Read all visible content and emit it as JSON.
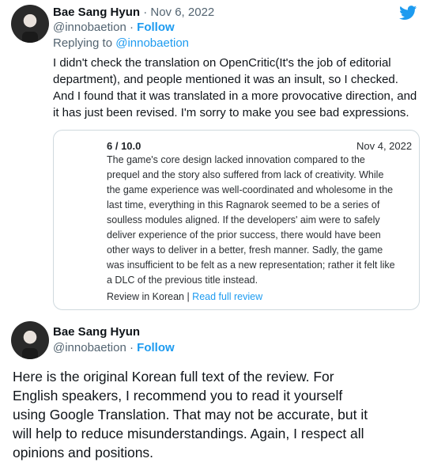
{
  "tweet1": {
    "name": "Bae Sang Hyun",
    "date_sep": " · ",
    "date": "Nov 6, 2022",
    "handle": "@innobaetion",
    "dot": " · ",
    "follow": "Follow",
    "replying_prefix": "Replying to ",
    "replying_handle": "@innobaetion",
    "body_lines": [
      "I didn't check the translation on OpenCritic(It's the job of editorial",
      "department), and people mentioned it was an insult, so I checked.",
      "And I found that it was translated in a more provocative direction, and",
      "it has just been revised. I'm sorry to make you see bad expressions."
    ]
  },
  "review_card": {
    "score": "6 / 10.0",
    "date": "Nov 4, 2022",
    "text_lines": [
      "The game's core design lacked innovation compared to the",
      "prequel and the story also suffered from lack of creativity. While",
      "the game experience was well-coordinated and wholesome in the",
      "last time, everything in this Ragnarok seemed to be a series of",
      "soulless modules aligned. If the developers' aim were to safely",
      "deliver experience of the prior success, there would have been",
      "other ways to deliver in a better, fresh manner. Sadly, the game",
      "was insufficient to be felt as a new representation; rather it felt like",
      "a DLC of the previous title instead."
    ],
    "footer_prefix": "Review in Korean | ",
    "footer_link": "Read full review"
  },
  "tweet2": {
    "name": "Bae Sang Hyun",
    "handle": "@innobaetion",
    "dot": " · ",
    "follow": "Follow",
    "body_lines": [
      "Here is the original Korean full text of the review. For",
      "English speakers, I recommend you to read it yourself",
      "using Google Translation. That may not be accurate, but it",
      "will help to reduce misunderstandings. Again, I respect all",
      "opinions and positions."
    ]
  },
  "colors": {
    "twitter_blue": "#1d9bf0",
    "muted_text": "#536471",
    "card_border": "#cfd9de"
  },
  "icons": {
    "brand": "twitter-bird-icon"
  }
}
